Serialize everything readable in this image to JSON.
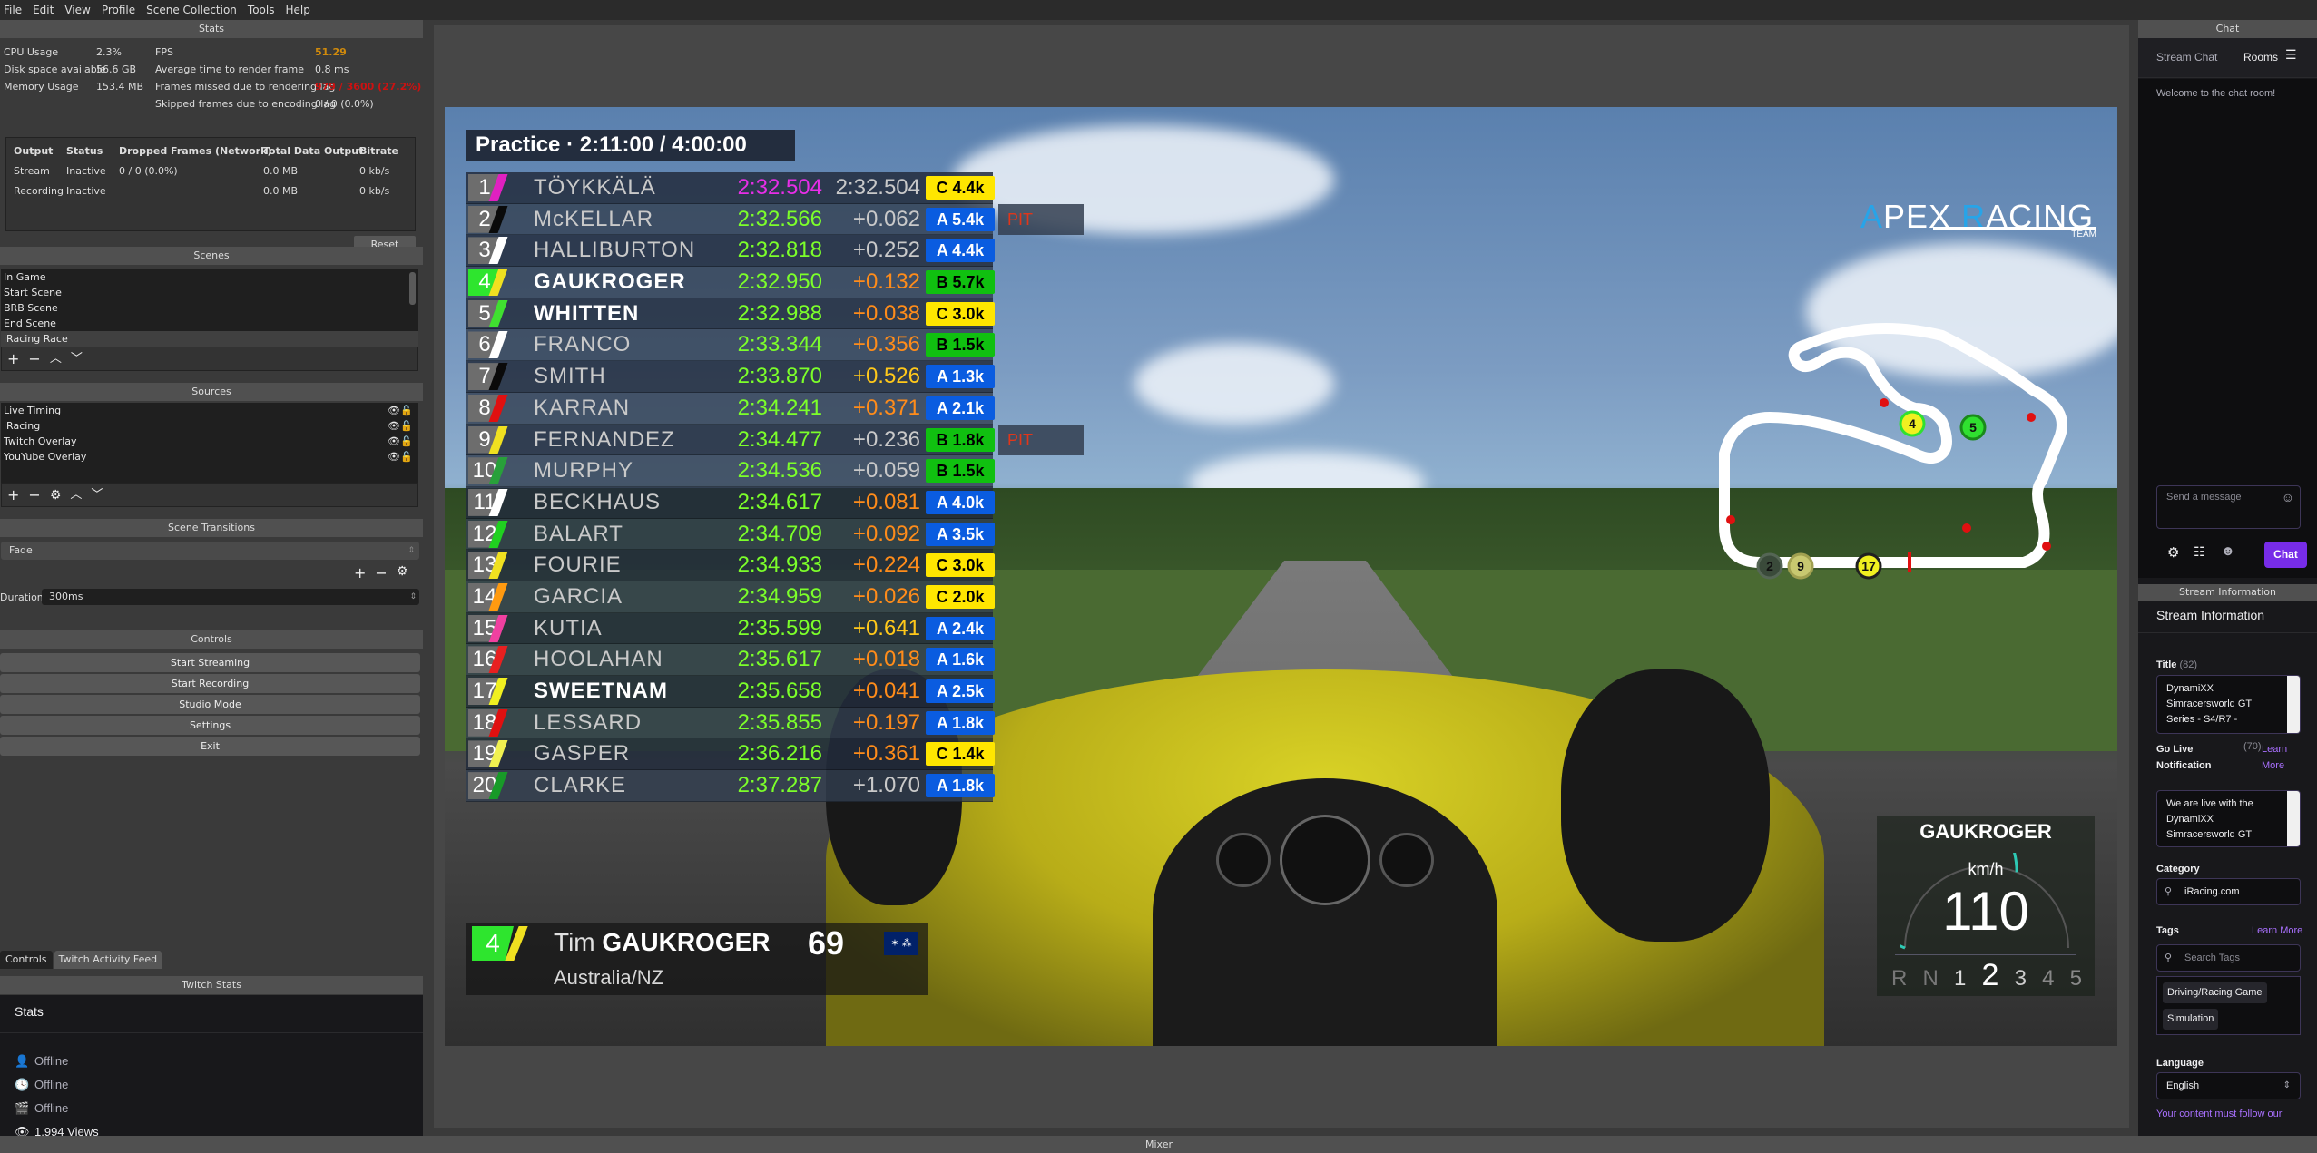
{
  "menu": [
    "File",
    "Edit",
    "View",
    "Profile",
    "Scene Collection",
    "Tools",
    "Help"
  ],
  "stats": {
    "dock_title": "Stats",
    "cpu_label": "CPU Usage",
    "cpu_value": "2.3%",
    "disk_label": "Disk space available",
    "disk_value": "56.6 GB",
    "mem_label": "Memory Usage",
    "mem_value": "153.4 MB",
    "fps_label": "FPS",
    "fps_value": "51.29",
    "render_label": "Average time to render frame",
    "render_value": "0.8 ms",
    "missed_label": "Frames missed due to rendering lag",
    "missed_value": "979 / 3600 (27.2%)",
    "skipped_label": "Skipped frames due to encoding lag",
    "skipped_value": "0 / 0 (0.0%)",
    "fps_color": "#d08a0c",
    "missed_color": "#cc1111",
    "table_headers": [
      "Output",
      "Status",
      "Dropped Frames (Network)",
      "Total Data Output",
      "Bitrate"
    ],
    "rows": [
      [
        "Stream",
        "Inactive",
        "0 / 0 (0.0%)",
        "0.0 MB",
        "0 kb/s"
      ],
      [
        "Recording",
        "Inactive",
        "",
        "0.0 MB",
        "0 kb/s"
      ]
    ],
    "reset_label": "Reset"
  },
  "scenes": {
    "dock_title": "Scenes",
    "items": [
      "In Game",
      "Start Scene",
      "BRB Scene",
      "End Scene",
      "iRacing Race"
    ],
    "selected": "iRacing Race"
  },
  "sources": {
    "dock_title": "Sources",
    "items": [
      "Live Timing",
      "iRacing",
      "Twitch Overlay",
      "YouYube Overlay"
    ]
  },
  "transitions": {
    "dock_title": "Scene Transitions",
    "selected": "Fade",
    "duration_label": "Duration",
    "duration_value": "300ms"
  },
  "controls": {
    "dock_title": "Controls",
    "buttons": [
      "Start Streaming",
      "Start Recording",
      "Studio Mode",
      "Settings",
      "Exit"
    ]
  },
  "bottom_tabs": [
    "Controls",
    "Twitch Activity Feed"
  ],
  "twitch_stats": {
    "dock_title": "Twitch Stats",
    "heading": "Stats",
    "items": [
      {
        "icon": "viewer-icon",
        "text": "Offline"
      },
      {
        "icon": "clock-icon",
        "text": "Offline"
      },
      {
        "icon": "clapper-icon",
        "text": "Offline"
      },
      {
        "icon": "eye-icon",
        "text": "1,994 Views"
      }
    ]
  },
  "overlay": {
    "session": "Practice · 2:11:00 / 4:00:00",
    "leaderboard": [
      {
        "pos": "1",
        "name": "TÖYKKÄLÄ",
        "best": "2:32.504",
        "gap": "2:32.504",
        "lic": "C 4.4k",
        "lic_class": "C",
        "stripe": "#e020c0",
        "best_color": "#e82ee8",
        "gap_color": "#c9c9c9",
        "bold": false,
        "pit": ""
      },
      {
        "pos": "2",
        "name": "McKELLAR",
        "best": "2:32.566",
        "gap": "+0.062",
        "lic": "A 5.4k",
        "lic_class": "A",
        "stripe": "#0a0a0a",
        "best_color": "#7cff2a",
        "gap_color": "#c9c9c9",
        "bold": false,
        "pit": "PIT"
      },
      {
        "pos": "3",
        "name": "HALLIBURTON",
        "best": "2:32.818",
        "gap": "+0.252",
        "lic": "A 4.4k",
        "lic_class": "A",
        "stripe": "#ffffff",
        "best_color": "#7cff2a",
        "gap_color": "#c9c9c9",
        "bold": false,
        "pit": ""
      },
      {
        "pos": "4",
        "name": "GAUKROGER",
        "best": "2:32.950",
        "gap": "+0.132",
        "lic": "B 5.7k",
        "lic_class": "B",
        "stripe": "#f0e020",
        "best_color": "#7cff2a",
        "gap_color": "#ff8c1a",
        "bold": true,
        "pit": "",
        "highlight": true
      },
      {
        "pos": "5",
        "name": "WHITTEN",
        "best": "2:32.988",
        "gap": "+0.038",
        "lic": "C 3.0k",
        "lic_class": "C",
        "stripe": "#40e030",
        "best_color": "#7cff2a",
        "gap_color": "#ff8c1a",
        "bold": true,
        "pit": ""
      },
      {
        "pos": "6",
        "name": "FRANCO",
        "best": "2:33.344",
        "gap": "+0.356",
        "lic": "B 1.5k",
        "lic_class": "B",
        "stripe": "#ffffff",
        "best_color": "#7cff2a",
        "gap_color": "#ff8c1a",
        "bold": false,
        "pit": ""
      },
      {
        "pos": "7",
        "name": "SMITH",
        "best": "2:33.870",
        "gap": "+0.526",
        "lic": "A 1.3k",
        "lic_class": "A",
        "stripe": "#0a0a0a",
        "best_color": "#7cff2a",
        "gap_color": "#ffc81a",
        "bold": false,
        "pit": ""
      },
      {
        "pos": "8",
        "name": "KARRAN",
        "best": "2:34.241",
        "gap": "+0.371",
        "lic": "A 2.1k",
        "lic_class": "A",
        "stripe": "#e01010",
        "best_color": "#7cff2a",
        "gap_color": "#ff8c1a",
        "bold": false,
        "pit": ""
      },
      {
        "pos": "9",
        "name": "FERNANDEZ",
        "best": "2:34.477",
        "gap": "+0.236",
        "lic": "B 1.8k",
        "lic_class": "B",
        "stripe": "#f0e020",
        "best_color": "#7cff2a",
        "gap_color": "#c9c9c9",
        "bold": false,
        "pit": "PIT"
      },
      {
        "pos": "10",
        "name": "MURPHY",
        "best": "2:34.536",
        "gap": "+0.059",
        "lic": "B 1.5k",
        "lic_class": "B",
        "stripe": "#28a03a",
        "best_color": "#7cff2a",
        "gap_color": "#c9c9c9",
        "bold": false,
        "pit": ""
      },
      {
        "pos": "11",
        "name": "BECKHAUS",
        "best": "2:34.617",
        "gap": "+0.081",
        "lic": "A 4.0k",
        "lic_class": "A",
        "stripe": "#ffffff",
        "best_color": "#7cff2a",
        "gap_color": "#ff8c1a",
        "bold": false,
        "pit": ""
      },
      {
        "pos": "12",
        "name": "BALART",
        "best": "2:34.709",
        "gap": "+0.092",
        "lic": "A 3.5k",
        "lic_class": "A",
        "stripe": "#20d020",
        "best_color": "#7cff2a",
        "gap_color": "#ff8c1a",
        "bold": false,
        "pit": ""
      },
      {
        "pos": "13",
        "name": "FOURIE",
        "best": "2:34.933",
        "gap": "+0.224",
        "lic": "C 3.0k",
        "lic_class": "C",
        "stripe": "#f0e020",
        "best_color": "#7cff2a",
        "gap_color": "#ff8c1a",
        "bold": false,
        "pit": ""
      },
      {
        "pos": "14",
        "name": "GARCIA",
        "best": "2:34.959",
        "gap": "+0.026",
        "lic": "C 2.0k",
        "lic_class": "C",
        "stripe": "#ff9a10",
        "best_color": "#7cff2a",
        "gap_color": "#ff8c1a",
        "bold": false,
        "pit": ""
      },
      {
        "pos": "15",
        "name": "KUTIA",
        "best": "2:35.599",
        "gap": "+0.641",
        "lic": "A 2.4k",
        "lic_class": "A",
        "stripe": "#f040a0",
        "best_color": "#7cff2a",
        "gap_color": "#ffc81a",
        "bold": false,
        "pit": ""
      },
      {
        "pos": "16",
        "name": "HOOLAHAN",
        "best": "2:35.617",
        "gap": "+0.018",
        "lic": "A 1.6k",
        "lic_class": "A",
        "stripe": "#e82020",
        "best_color": "#7cff2a",
        "gap_color": "#ff8c1a",
        "bold": false,
        "pit": ""
      },
      {
        "pos": "17",
        "name": "SWEETNAM",
        "best": "2:35.658",
        "gap": "+0.041",
        "lic": "A 2.5k",
        "lic_class": "A",
        "stripe": "#f0f020",
        "best_color": "#7cff2a",
        "gap_color": "#ff8c1a",
        "bold": true,
        "pit": ""
      },
      {
        "pos": "18",
        "name": "LESSARD",
        "best": "2:35.855",
        "gap": "+0.197",
        "lic": "A 1.8k",
        "lic_class": "A",
        "stripe": "#e01010",
        "best_color": "#7cff2a",
        "gap_color": "#ff8c1a",
        "bold": false,
        "pit": ""
      },
      {
        "pos": "19",
        "name": "GASPER",
        "best": "2:36.216",
        "gap": "+0.361",
        "lic": "C 1.4k",
        "lic_class": "C",
        "stripe": "#f0f050",
        "best_color": "#7cff2a",
        "gap_color": "#ff8c1a",
        "bold": false,
        "pit": ""
      },
      {
        "pos": "20",
        "name": "CLARKE",
        "best": "2:37.287",
        "gap": "+1.070",
        "lic": "A 1.8k",
        "lic_class": "A",
        "stripe": "#189a28",
        "best_color": "#7cff2a",
        "gap_color": "#c9c9c9",
        "bold": false,
        "pit": ""
      }
    ],
    "license_colors": {
      "A": {
        "bg": "#0a5ce0",
        "fg": "#ffffff"
      },
      "B": {
        "bg": "#10c010",
        "fg": "#000000"
      },
      "C": {
        "bg": "#ffe600",
        "fg": "#000000"
      }
    },
    "logo_a": "A",
    "logo_pex": "PEX ",
    "logo_r": "R",
    "logo_acing": "ACING",
    "logo_team": "TEAM",
    "map_markers": [
      {
        "label": "4",
        "fill": "#f0f020",
        "ring": "#30e030"
      },
      {
        "label": "5",
        "fill": "#30e030",
        "ring": "#1a8a1a"
      },
      {
        "label": "2",
        "fill": "#3a4a3a",
        "ring": "#556655"
      },
      {
        "label": "9",
        "fill": "#c8c870",
        "ring": "#a0a050"
      },
      {
        "label": "17",
        "fill": "#f0f020",
        "ring": "#202020"
      }
    ],
    "driver": {
      "pos": "4",
      "first": "Tim",
      "last": "GAUKROGER",
      "number": "69",
      "club": "Australia/NZ",
      "flag": "australia-flag-icon"
    },
    "speedo": {
      "driver": "GAUKROGER",
      "unit": "km/h",
      "speed": "110",
      "gears": [
        "R",
        "N",
        "1",
        "2",
        "3",
        "4",
        "5"
      ],
      "current_gear": "2",
      "arc_fraction": 0.62,
      "arc_color": "#2ec9b4"
    }
  },
  "chat": {
    "dock_title": "Chat",
    "tab_stream_chat": "Stream Chat",
    "tab_rooms": "Rooms",
    "welcome": "Welcome to the chat room!",
    "input_placeholder": "Send a message",
    "send_label": "Chat",
    "accent": "#772ce8"
  },
  "stream_info": {
    "dock_title": "Stream Information",
    "heading": "Stream Information",
    "title_label": "Title",
    "title_count": "(82)",
    "title_value": "DynamiXX Simracersworld GT Series - S4/R7 -",
    "notif_label": "Go Live Notification",
    "notif_count": "(70)",
    "learn_more": "Learn More",
    "notif_value": "We are live with the DynamiXX Simracersworld GT",
    "category_label": "Category",
    "category_value": "iRacing.com",
    "tags_label": "Tags",
    "tags_learn_more": "Learn More",
    "tags_placeholder": "Search Tags",
    "tags": [
      "Driving/Racing Game",
      "Simulation"
    ],
    "language_label": "Language",
    "language_value": "English",
    "footer_text": "Your content must follow our"
  },
  "mixer": {
    "dock_title": "Mixer"
  }
}
